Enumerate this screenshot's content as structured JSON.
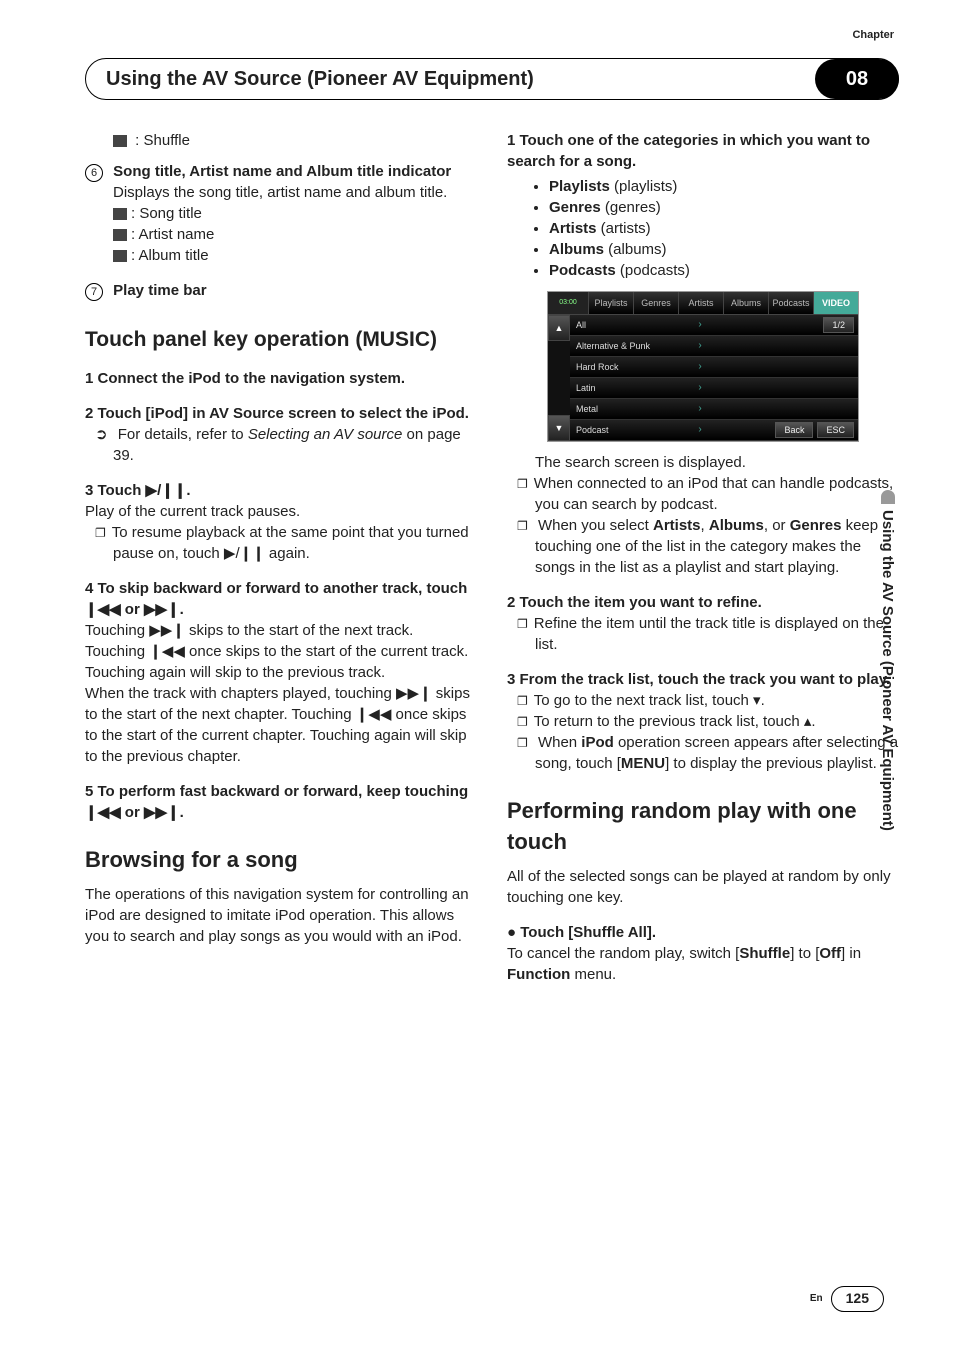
{
  "chapter_label": "Chapter",
  "chapter_num": "08",
  "header_title": "Using the AV Source (Pioneer AV Equipment)",
  "side_tab": "Using the AV Source (Pioneer AV Equipment)",
  "left": {
    "shuffle_label": ": Shuffle",
    "item6_num": "6",
    "item6_title": "Song title, Artist name and Album title indicator",
    "item6_desc": "Displays the song title, artist name and album title.",
    "item6_a": ": Song title",
    "item6_b": ": Artist name",
    "item6_c": ": Album title",
    "item7_num": "7",
    "item7_title": "Play time bar",
    "music_head": "Touch panel key operation (MUSIC)",
    "s1": "1    Connect the iPod to the navigation system.",
    "s2": "2    Touch [iPod] in AV Source screen to select the iPod.",
    "s2_detail_a": "For details, refer to ",
    "s2_detail_b": "Selecting an AV source",
    "s2_detail_c": " on page 39.",
    "s3": "3    Touch ▶/❙❙.",
    "s3_line": "Play of the current track pauses.",
    "s3_box": "To resume playback at the same point that you turned pause on, touch ▶/❙❙ again.",
    "s4": "4    To skip backward or forward to another track, touch ❙◀◀ or ▶▶❙.",
    "s4_p1": "Touching ▶▶❙ skips to the start of the next track. Touching ❙◀◀ once skips to the start of the current track. Touching again will skip to the previous track.",
    "s4_p2": "When the track with chapters played, touching ▶▶❙ skips to the start of the next chapter. Touching ❙◀◀ once skips to the start of the current chapter. Touching again will skip to the previous chapter.",
    "s5": "5    To perform fast backward or forward, keep touching ❙◀◀ or ▶▶❙.",
    "browse_head": "Browsing for a song",
    "browse_p": "The operations of this navigation system for controlling an iPod are designed to imitate iPod operation. This allows you to search and play songs as you would with an iPod."
  },
  "right": {
    "r1": "1    Touch one of the categories in which you want to search for a song.",
    "cats": [
      {
        "b": "Playlists",
        "p": " (playlists)"
      },
      {
        "b": "Genres",
        "p": " (genres)"
      },
      {
        "b": "Artists",
        "p": " (artists)"
      },
      {
        "b": "Albums",
        "p": " (albums)"
      },
      {
        "b": "Podcasts",
        "p": " (podcasts)"
      }
    ],
    "ss": {
      "time": "03:00",
      "tabs": [
        "Playlists",
        "Genres",
        "Artists",
        "Albums",
        "Podcasts"
      ],
      "video": "VIDEO",
      "rows": [
        "All",
        "Alternative & Punk",
        "Hard Rock",
        "Latin",
        "Metal",
        "Podcast"
      ],
      "page": "1/2",
      "back": "Back",
      "esc": "ESC"
    },
    "r1_after": "The search screen is displayed.",
    "r1_box1": "When connected to an iPod that can handle podcasts, you can search by podcast.",
    "r1_box2a": "When you select ",
    "r1_box2b": "Artists",
    "r1_box2c": ", ",
    "r1_box2d": "Albums",
    "r1_box2e": ", or ",
    "r1_box2f": "Genres",
    "r1_box2g": " keep touching one of the list in the category makes the songs in the list as a playlist and start playing.",
    "r2": "2    Touch the item you want to refine.",
    "r2_box": "Refine the item until the track title is displayed on the list.",
    "r3": "3    From the track list, touch the track you want to play.",
    "r3_box1": "To go to the next track list, touch ▾.",
    "r3_box2": "To return to the previous track list, touch ▴.",
    "r3_box3a": "When ",
    "r3_box3b": "iPod",
    "r3_box3c": " operation screen appears after selecting a song, touch [",
    "r3_box3d": "MENU",
    "r3_box3e": "] to display the previous playlist.",
    "random_head": "Performing random play with one touch",
    "random_p": "All of the selected songs can be played at random by only touching one key.",
    "random_step": "●   Touch [Shuffle All].",
    "random_p2a": "To cancel the random play, switch [",
    "random_p2b": "Shuffle",
    "random_p2c": "] to [",
    "random_p2d": "Off",
    "random_p2e": "] in ",
    "random_p2f": "Function",
    "random_p2g": " menu."
  },
  "footer_en": "En",
  "footer_page": "125"
}
